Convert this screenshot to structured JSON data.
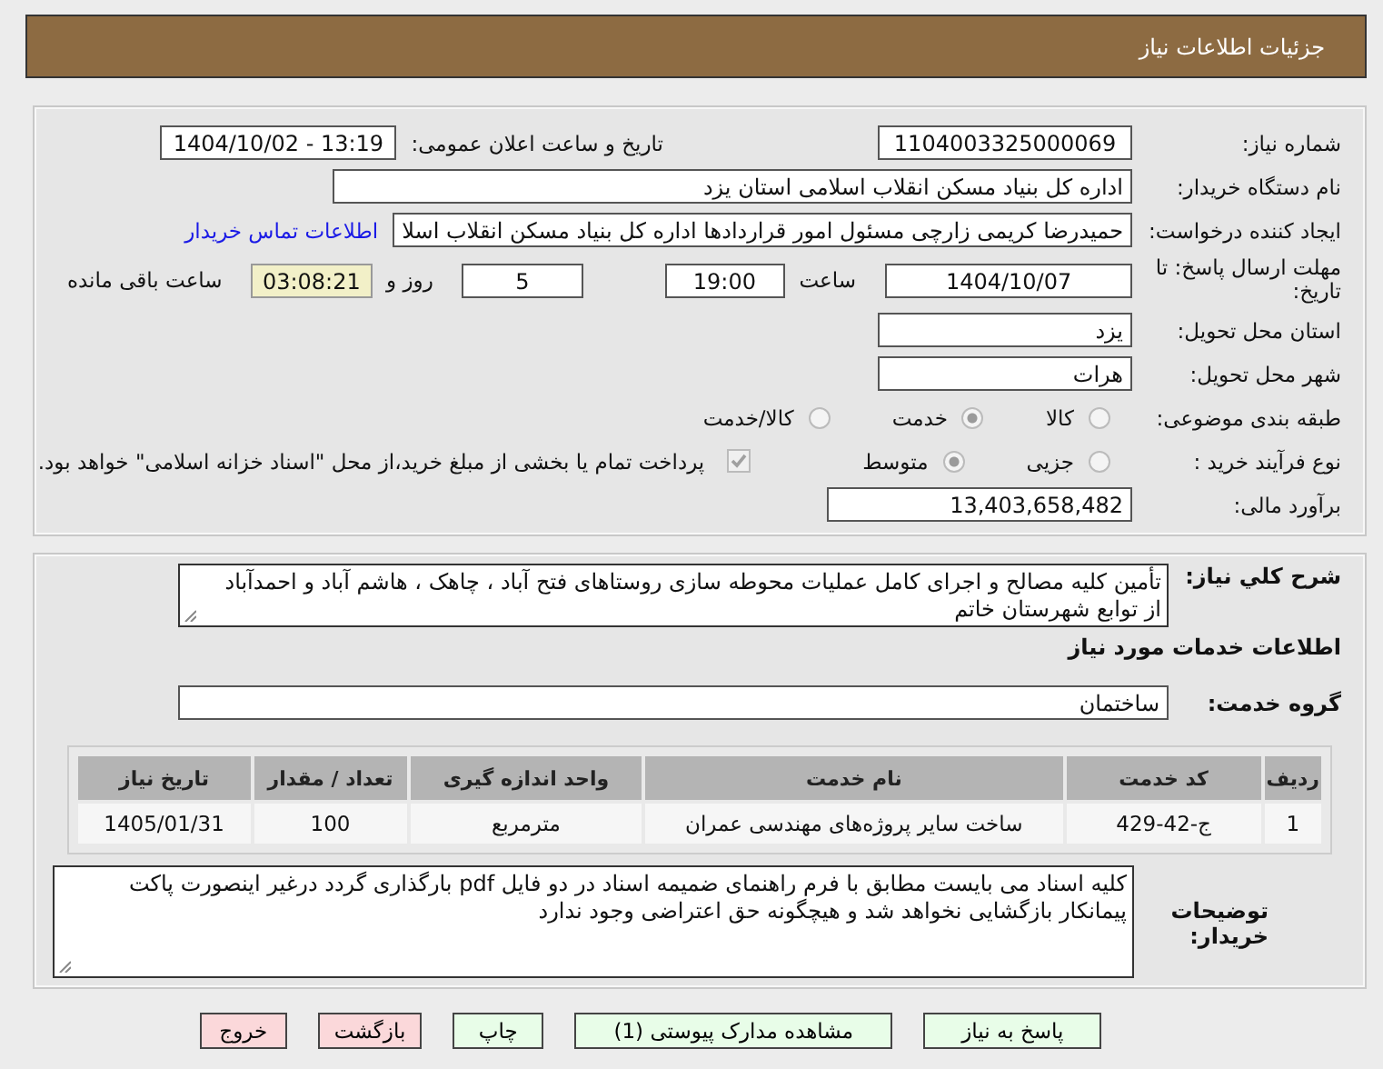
{
  "header": {
    "title": "جزئیات اطلاعات نیاز"
  },
  "need_number": {
    "label": "شماره نیاز:",
    "value": "1104003325000069"
  },
  "announce": {
    "label": "تاریخ و ساعت اعلان عمومی:",
    "value": "1404/10/02 - 13:19"
  },
  "buyer": {
    "label": "نام دستگاه خریدار:",
    "value": "اداره کل بنیاد مسکن انقلاب اسلامی استان یزد"
  },
  "requester": {
    "label": "ایجاد کننده درخواست:",
    "value": "حمیدرضا کریمی زارچی مسئول امور قراردادها اداره کل بنیاد مسکن انقلاب اسلا",
    "link": "اطلاعات تماس خریدار"
  },
  "deadline": {
    "label": "مهلت ارسال پاسخ: تا تاریخ:",
    "date": "1404/10/07",
    "time_label": "ساعت",
    "time": "19:00",
    "days": "5",
    "days_label": "روز و",
    "remaining": "03:08:21",
    "remaining_label": "ساعت باقی مانده"
  },
  "province": {
    "label": "استان محل تحویل:",
    "value": "یزد"
  },
  "city": {
    "label": "شهر محل تحویل:",
    "value": "هرات"
  },
  "classification": {
    "label": "طبقه بندی موضوعی:",
    "options": [
      {
        "label": "کالا",
        "selected": false
      },
      {
        "label": "خدمت",
        "selected": true
      },
      {
        "label": "کالا/خدمت",
        "selected": false
      }
    ]
  },
  "purchase_type": {
    "label": "نوع فرآیند خرید :",
    "options": [
      {
        "label": "جزیی",
        "selected": false
      },
      {
        "label": "متوسط",
        "selected": true
      }
    ],
    "payment_checkbox": {
      "checked": true,
      "label": "پرداخت تمام یا بخشی از مبلغ خرید،از محل \"اسناد خزانه اسلامی\" خواهد بود."
    }
  },
  "budget": {
    "label": "برآورد مالی:",
    "value": "13,403,658,482"
  },
  "description": {
    "label": "شرح کلي نیاز:",
    "value": "تأمین کلیه مصالح و اجرای کامل عملیات محوطه سازی روستاهای فتح آباد ، چاهک ، هاشم آباد و احمدآباد از توابع شهرستان خاتم"
  },
  "services_heading": "اطلاعات خدمات مورد نیاز",
  "service_group": {
    "label": "گروه خدمت:",
    "value": "ساختمان"
  },
  "table": {
    "columns": [
      "ردیف",
      "کد خدمت",
      "نام خدمت",
      "واحد اندازه گیری",
      "تعداد / مقدار",
      "تاریخ نیاز"
    ],
    "rows": [
      [
        "1",
        "ج-42-429",
        "ساخت سایر پروژه‌های مهندسی عمران",
        "مترمربع",
        "100",
        "1405/01/31"
      ]
    ]
  },
  "buyer_notes": {
    "label": "توضیحات خریدار:",
    "value": "کلیه اسناد می بایست مطابق با فرم راهنمای ضمیمه اسناد در دو فایل pdf بارگذاری گردد درغیر اینصورت  پاکت پیمانکار بازگشایی نخواهد شد و هیچگونه حق اعتراضی وجود ندارد"
  },
  "buttons": [
    {
      "label": "پاسخ به نیاز",
      "kind": "action"
    },
    {
      "label": "مشاهده مدارک پیوستی (1)",
      "kind": "action"
    },
    {
      "label": "چاپ",
      "kind": "action"
    },
    {
      "label": "بازگشت",
      "kind": "exit"
    },
    {
      "label": "خروج",
      "kind": "exit"
    }
  ]
}
